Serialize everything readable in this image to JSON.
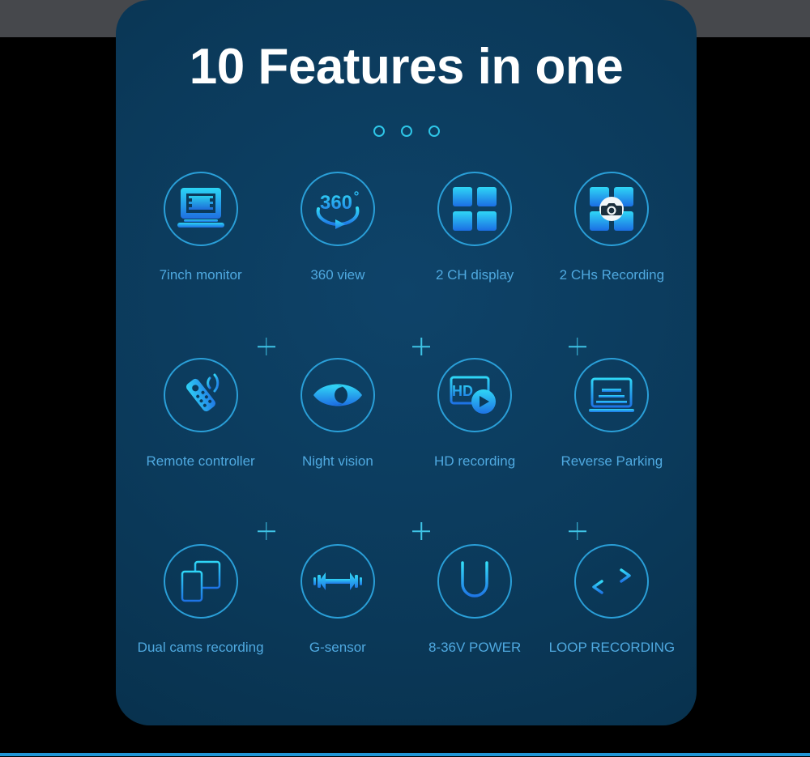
{
  "page": {
    "background_color": "#000000",
    "top_bar_color": "#46484c",
    "bottom_rule_color": "#2196d6"
  },
  "card": {
    "title": "10 Features in one",
    "background_color": "#0b3a5b",
    "accent_color": "#2ec6e8",
    "label_color": "#4fa9e0",
    "pager_dots": [
      {
        "name": "dot-1",
        "active": false
      },
      {
        "name": "dot-2",
        "active": false
      },
      {
        "name": "dot-3",
        "active": false
      }
    ]
  },
  "features": [
    {
      "label": "7inch monitor",
      "icon": "monitor-icon"
    },
    {
      "label": "360 view",
      "icon": "360-view-icon"
    },
    {
      "label": "2 CH display",
      "icon": "grid-four-icon"
    },
    {
      "label": "2 CHs Recording",
      "icon": "grid-camera-icon"
    },
    {
      "label": "Remote controller",
      "icon": "remote-control-icon"
    },
    {
      "label": "Night vision",
      "icon": "night-eye-icon"
    },
    {
      "label": "HD recording",
      "icon": "hd-play-icon"
    },
    {
      "label": "Reverse Parking",
      "icon": "reverse-parking-icon"
    },
    {
      "label": "Dual cams recording",
      "icon": "dual-screens-icon"
    },
    {
      "label": "G-sensor",
      "icon": "dumbbell-icon"
    },
    {
      "label": "8-36V POWER",
      "icon": "u-power-icon"
    },
    {
      "label": "LOOP RECORDING",
      "icon": "loop-arrows-icon"
    }
  ],
  "separators": {
    "label": "+",
    "row_1": [
      "+",
      "+",
      "+"
    ],
    "row_2": [
      "+",
      "+",
      "+"
    ]
  },
  "icon_text": {
    "three_sixty": "360",
    "degree": "°",
    "hd": "HD",
    "u": "U"
  }
}
